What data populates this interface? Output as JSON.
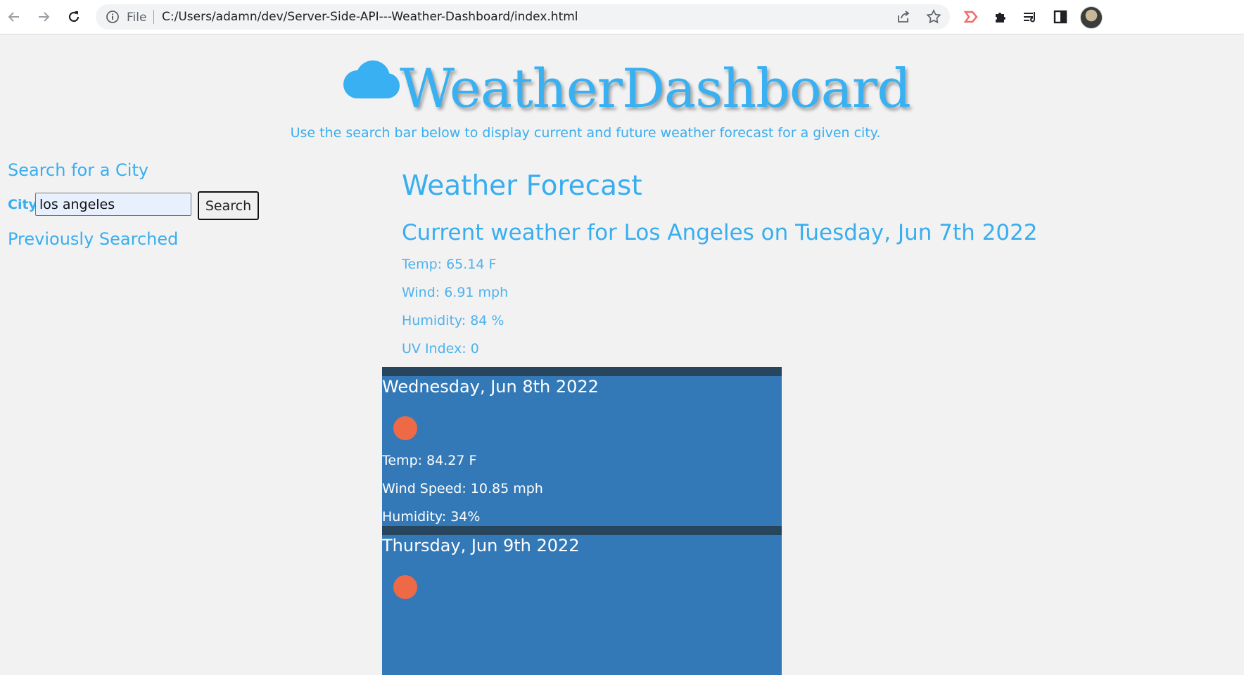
{
  "browser": {
    "file_label": "File",
    "url": "C:/Users/adamn/dev/Server-Side-API---Weather-Dashboard/index.html"
  },
  "header": {
    "title": "WeatherDashboard",
    "subtitle": "Use the search bar below to display current and future weather forecast for a given city.",
    "accent_color": "#38aef0"
  },
  "sidebar": {
    "search_heading": "Search for a City",
    "city_label": "City",
    "city_value": "los angeles",
    "search_button": "Search",
    "previous_heading": "Previously Searched"
  },
  "main": {
    "forecast_title": "Weather Forecast",
    "current_title": "Current weather for Los Angeles on Tuesday, Jun 7th 2022",
    "current": {
      "temp": "Temp: 65.14 F",
      "wind": "Wind: 6.91 mph",
      "humidity": "Humidity: 84 %",
      "uv": "UV Index: 0"
    },
    "days": [
      {
        "date": "Wednesday, Jun 8th 2022",
        "icon": "sun-icon",
        "temp": "Temp: 84.27 F",
        "wind": "Wind Speed: 10.85 mph",
        "humidity": "Humidity: 34%"
      },
      {
        "date": "Thursday, Jun 9th 2022",
        "icon": "sun-icon"
      }
    ],
    "card_color": "#3479b7",
    "card_bar_color": "#27465e",
    "sun_color": "#ee6a47"
  }
}
